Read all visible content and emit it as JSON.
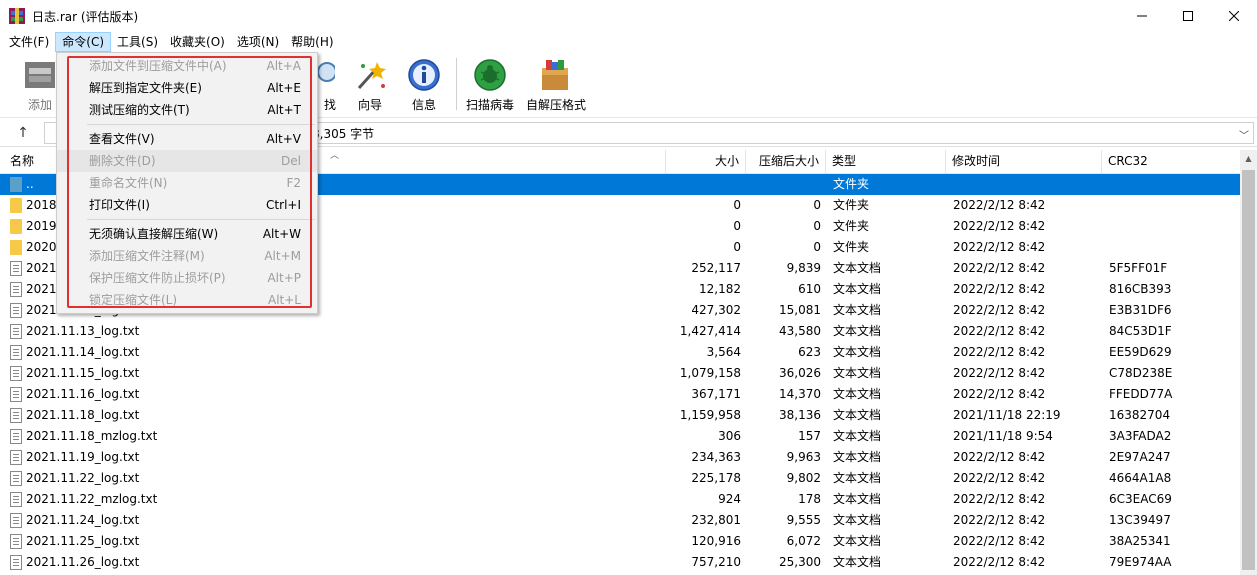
{
  "window": {
    "title": "日志.rar (评估版本)"
  },
  "menubar": {
    "items": [
      "文件(F)",
      "命令(C)",
      "工具(S)",
      "收藏夹(O)",
      "选项(N)",
      "帮助(H)"
    ],
    "active_index": 1
  },
  "toolbar": {
    "add_label": "添加",
    "find_label": "找",
    "wizard_label": "向导",
    "info_label": "信息",
    "scan_label": "扫描病毒",
    "sfx_label": "自解压格式"
  },
  "address": {
    "text": "8,305 字节"
  },
  "columns": [
    "名称",
    "大小",
    "压缩后大小",
    "类型",
    "修改时间",
    "CRC32"
  ],
  "rows": [
    {
      "name": "..",
      "size": "",
      "packed": "",
      "type": "文件夹",
      "mtime": "",
      "crc": "",
      "kind": "up",
      "selected": true
    },
    {
      "name": "2018",
      "size": "0",
      "packed": "0",
      "type": "文件夹",
      "mtime": "2022/2/12 8:42",
      "crc": "",
      "kind": "folder"
    },
    {
      "name": "2019",
      "size": "0",
      "packed": "0",
      "type": "文件夹",
      "mtime": "2022/2/12 8:42",
      "crc": "",
      "kind": "folder"
    },
    {
      "name": "2020",
      "size": "0",
      "packed": "0",
      "type": "文件夹",
      "mtime": "2022/2/12 8:42",
      "crc": "",
      "kind": "folder"
    },
    {
      "name": "2021",
      "size": "252,117",
      "packed": "9,839",
      "type": "文本文档",
      "mtime": "2022/2/12 8:42",
      "crc": "5F5FF01F",
      "kind": "file"
    },
    {
      "name": "2021",
      "size": "12,182",
      "packed": "610",
      "type": "文本文档",
      "mtime": "2022/2/12 8:42",
      "crc": "816CB393",
      "kind": "file"
    },
    {
      "name": "2021.11.11_log.txt",
      "size": "427,302",
      "packed": "15,081",
      "type": "文本文档",
      "mtime": "2022/2/12 8:42",
      "crc": "E3B31DF6",
      "kind": "file"
    },
    {
      "name": "2021.11.13_log.txt",
      "size": "1,427,414",
      "packed": "43,580",
      "type": "文本文档",
      "mtime": "2022/2/12 8:42",
      "crc": "84C53D1F",
      "kind": "file"
    },
    {
      "name": "2021.11.14_log.txt",
      "size": "3,564",
      "packed": "623",
      "type": "文本文档",
      "mtime": "2022/2/12 8:42",
      "crc": "EE59D629",
      "kind": "file"
    },
    {
      "name": "2021.11.15_log.txt",
      "size": "1,079,158",
      "packed": "36,026",
      "type": "文本文档",
      "mtime": "2022/2/12 8:42",
      "crc": "C78D238E",
      "kind": "file"
    },
    {
      "name": "2021.11.16_log.txt",
      "size": "367,171",
      "packed": "14,370",
      "type": "文本文档",
      "mtime": "2022/2/12 8:42",
      "crc": "FFEDD77A",
      "kind": "file"
    },
    {
      "name": "2021.11.18_log.txt",
      "size": "1,159,958",
      "packed": "38,136",
      "type": "文本文档",
      "mtime": "2021/11/18 22:19",
      "crc": "16382704",
      "kind": "file"
    },
    {
      "name": "2021.11.18_mzlog.txt",
      "size": "306",
      "packed": "157",
      "type": "文本文档",
      "mtime": "2021/11/18 9:54",
      "crc": "3A3FADA2",
      "kind": "file"
    },
    {
      "name": "2021.11.19_log.txt",
      "size": "234,363",
      "packed": "9,963",
      "type": "文本文档",
      "mtime": "2022/2/12 8:42",
      "crc": "2E97A247",
      "kind": "file"
    },
    {
      "name": "2021.11.22_log.txt",
      "size": "225,178",
      "packed": "9,802",
      "type": "文本文档",
      "mtime": "2022/2/12 8:42",
      "crc": "4664A1A8",
      "kind": "file"
    },
    {
      "name": "2021.11.22_mzlog.txt",
      "size": "924",
      "packed": "178",
      "type": "文本文档",
      "mtime": "2022/2/12 8:42",
      "crc": "6C3EAC69",
      "kind": "file"
    },
    {
      "name": "2021.11.24_log.txt",
      "size": "232,801",
      "packed": "9,555",
      "type": "文本文档",
      "mtime": "2022/2/12 8:42",
      "crc": "13C39497",
      "kind": "file"
    },
    {
      "name": "2021.11.25_log.txt",
      "size": "120,916",
      "packed": "6,072",
      "type": "文本文档",
      "mtime": "2022/2/12 8:42",
      "crc": "38A25341",
      "kind": "file"
    },
    {
      "name": "2021.11.26_log.txt",
      "size": "757,210",
      "packed": "25,300",
      "type": "文本文档",
      "mtime": "2022/2/12 8:42",
      "crc": "79E974AA",
      "kind": "file"
    }
  ],
  "command_menu": {
    "items": [
      {
        "label": "添加文件到压缩文件中(A)",
        "shortcut": "Alt+A",
        "disabled": true
      },
      {
        "label": "解压到指定文件夹(E)",
        "shortcut": "Alt+E",
        "disabled": false
      },
      {
        "label": "测试压缩的文件(T)",
        "shortcut": "Alt+T",
        "disabled": false
      },
      {
        "label": "查看文件(V)",
        "shortcut": "Alt+V",
        "disabled": false
      },
      {
        "label": "删除文件(D)",
        "shortcut": "Del",
        "disabled": true,
        "hover": true
      },
      {
        "label": "重命名文件(N)",
        "shortcut": "F2",
        "disabled": true
      },
      {
        "label": "打印文件(I)",
        "shortcut": "Ctrl+I",
        "disabled": false
      },
      {
        "label": "无须确认直接解压缩(W)",
        "shortcut": "Alt+W",
        "disabled": false
      },
      {
        "label": "添加压缩文件注释(M)",
        "shortcut": "Alt+M",
        "disabled": true
      },
      {
        "label": "保护压缩文件防止损坏(P)",
        "shortcut": "Alt+P",
        "disabled": true
      },
      {
        "label": "锁定压缩文件(L)",
        "shortcut": "Alt+L",
        "disabled": true
      }
    ]
  }
}
